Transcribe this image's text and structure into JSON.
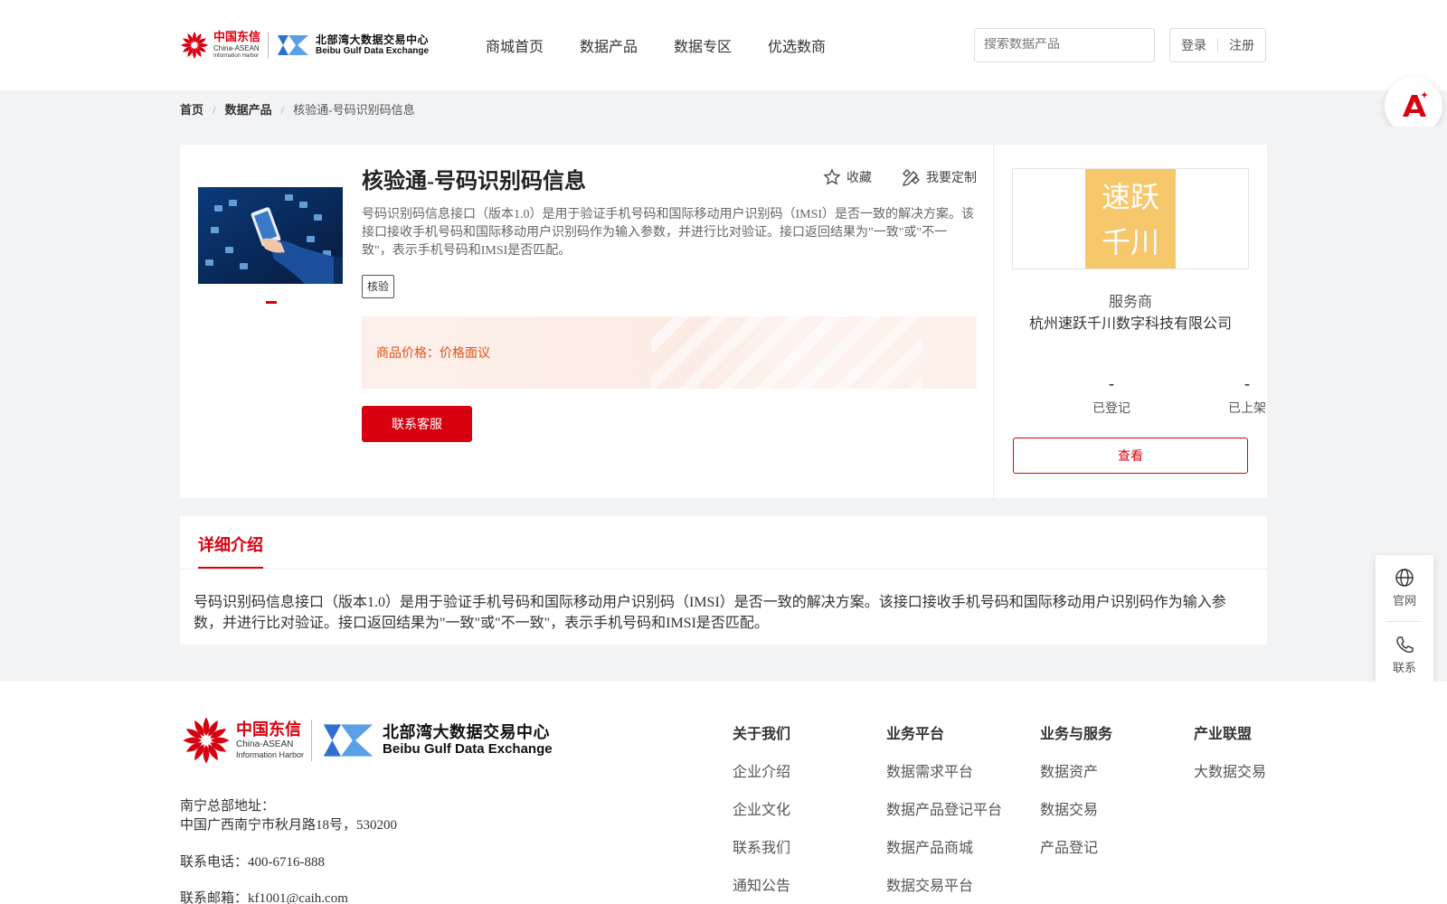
{
  "header": {
    "logo_cn": "中国东信",
    "logo_en1": "China-ASEAN",
    "logo_en2": "Information Harbor",
    "logo2_cn": "北部湾大数据交易中心",
    "logo2_en": "Beibu Gulf Data Exchange",
    "nav": [
      "商城首页",
      "数据产品",
      "数据专区",
      "优选数商"
    ],
    "search_placeholder": "搜索数据产品",
    "login": "登录",
    "register": "注册"
  },
  "breadcrumb": {
    "home": "首页",
    "category": "数据产品",
    "current": "核验通-号码识别码信息"
  },
  "product": {
    "title": "核验通-号码识别码信息",
    "favorite": "收藏",
    "customize": "我要定制",
    "description": "号码识别码信息接口（版本1.0）是用于验证手机号码和国际移动用户识别码（IMSI）是否一致的解决方案。该接口接收手机号码和国际移动用户识别码作为输入参数，并进行比对验证。接口返回结果为\"一致\"或\"不一致\"，表示手机号码和IMSI是否匹配。",
    "tag": "核验",
    "price_label": "商品价格：",
    "price_value": "价格面议",
    "contact_button": "联系客服"
  },
  "seller": {
    "logo_line1": "速跃",
    "logo_line2": "千川",
    "role": "服务商",
    "name": "杭州速跃千川数字科技有限公司",
    "registered_value": "-",
    "registered_label": "已登记",
    "listed_value": "-",
    "listed_label": "已上架",
    "view_button": "查看"
  },
  "detail": {
    "tab": "详细介绍",
    "text": "号码识别码信息接口（版本1.0）是用于验证手机号码和国际移动用户识别码（IMSI）是否一致的解决方案。该接口接收手机号码和国际移动用户识别码作为输入参数，并进行比对验证。接口返回结果为\"一致\"或\"不一致\"，表示手机号码和IMSI是否匹配。"
  },
  "side": {
    "website": "官网",
    "contact": "联系"
  },
  "footer": {
    "address_label": "南宁总部地址：",
    "address": "中国广西南宁市秋月路18号，530200",
    "phone": "联系电话：400-6716-888",
    "email": "联系邮箱：kf1001@caih.com",
    "columns": [
      {
        "title": "关于我们",
        "items": [
          "企业介绍",
          "企业文化",
          "联系我们",
          "通知公告"
        ]
      },
      {
        "title": "业务平台",
        "items": [
          "数据需求平台",
          "数据产品登记平台",
          "数据产品商城",
          "数据交易平台"
        ]
      },
      {
        "title": "业务与服务",
        "items": [
          "数据资产",
          "数据交易",
          "产品登记"
        ]
      },
      {
        "title": "产业联盟",
        "items": [
          "大数据交易"
        ]
      }
    ]
  },
  "colors": {
    "brand_red": "#d7000f",
    "price_orange": "#e0511a",
    "page_gray": "#f2f3f5"
  }
}
